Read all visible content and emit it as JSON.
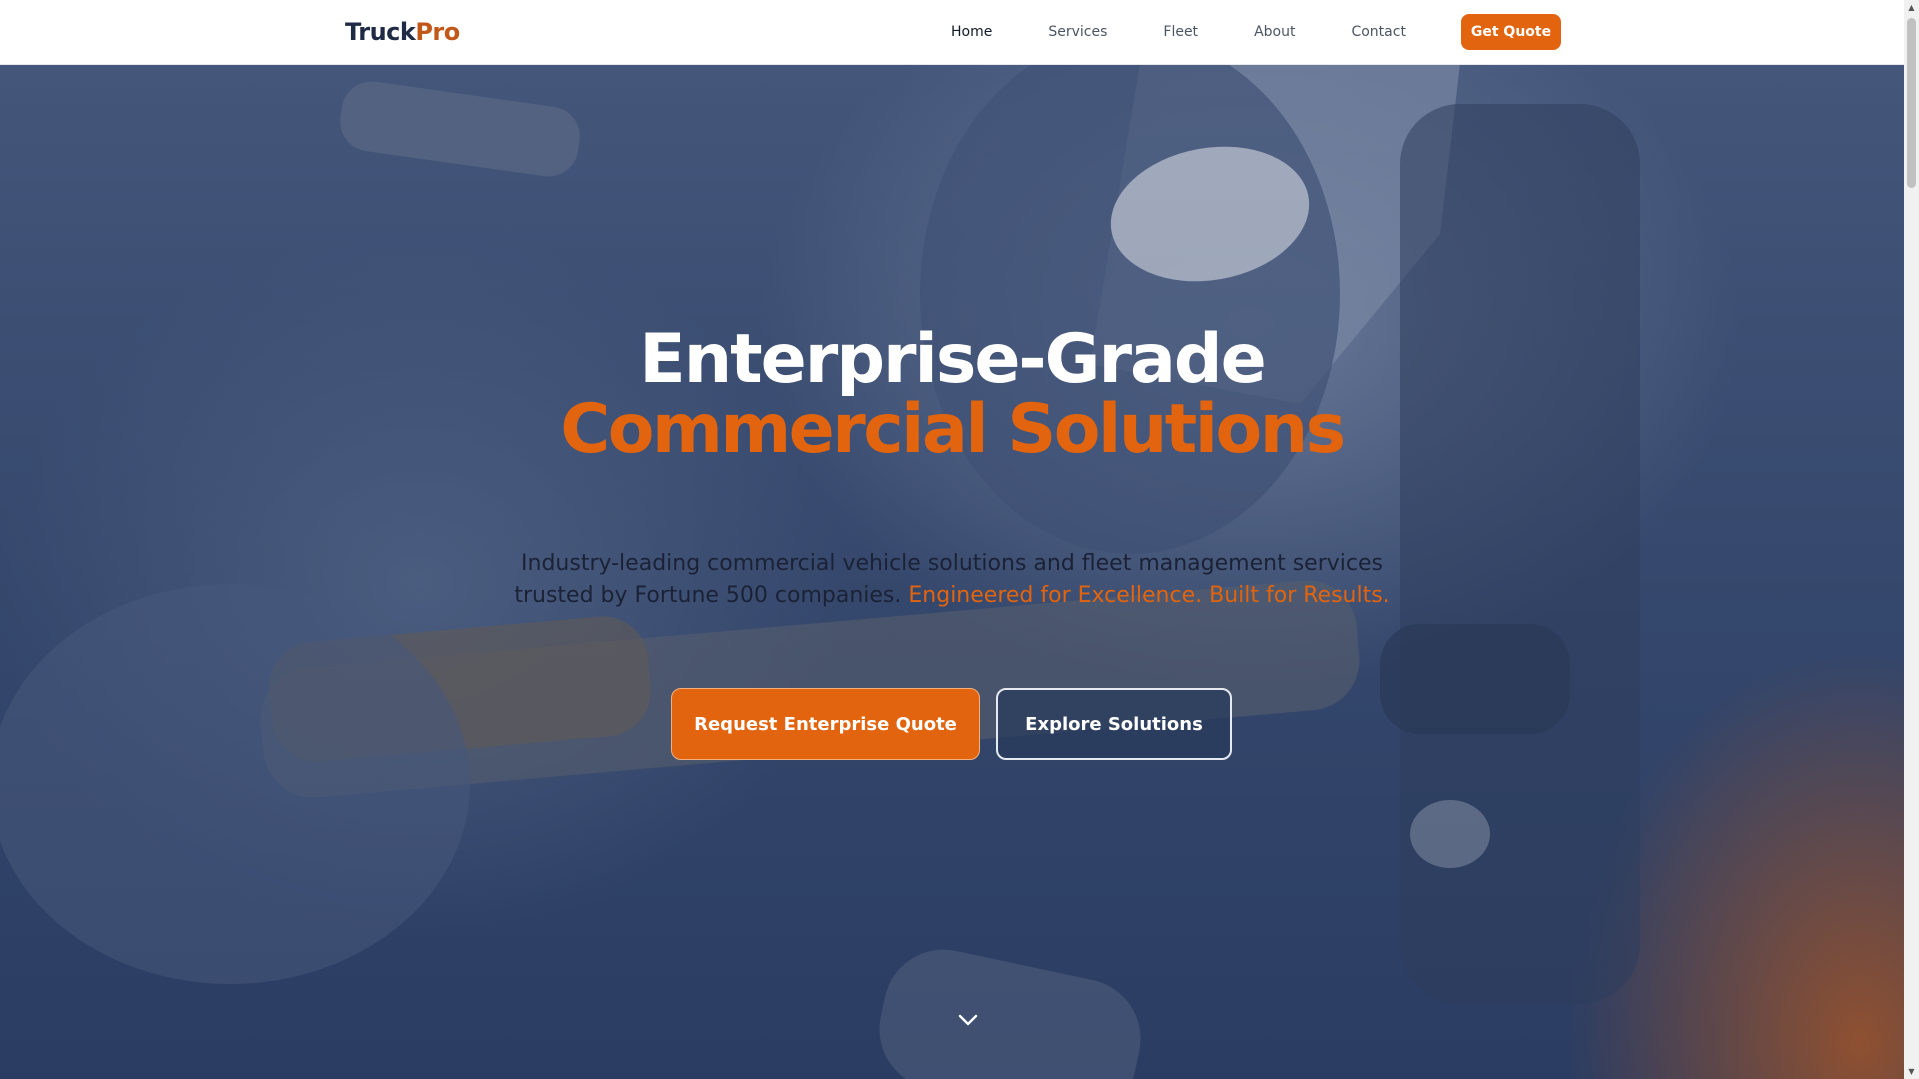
{
  "nav": {
    "logo_part1": "Truck",
    "logo_part2": "Pro",
    "links": [
      "Home",
      "Services",
      "Fleet",
      "About",
      "Contact"
    ],
    "active": "Home",
    "cta_label": "Get Quote"
  },
  "hero": {
    "title_line1": "Enterprise-Grade",
    "title_line2": "Commercial Solutions",
    "subtitle": "Industry-leading commercial vehicle solutions and fleet management services trusted by Fortune 500 companies.",
    "subtitle_highlight": "Engineered for Excellence. Built for Results.",
    "primary_button": "Request Enterprise Quote",
    "secondary_button": "Explore Solutions",
    "scroll_icon": "chevron-down-icon"
  },
  "colors": {
    "accent": "#e2640e",
    "navy": "#1f2a44",
    "hero_overlay": "#3c4f74"
  }
}
